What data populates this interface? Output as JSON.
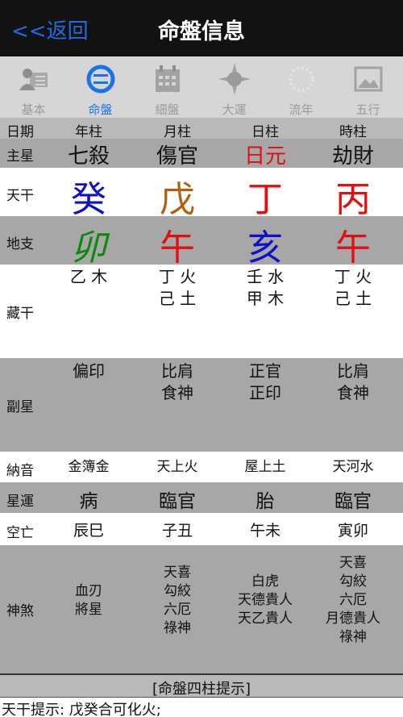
{
  "nav": {
    "back_label": "<<返回",
    "title": "命盤信息"
  },
  "tabs": [
    {
      "label": "基本",
      "icon": "person-card-icon"
    },
    {
      "label": "命盤",
      "icon": "chart-circle-icon",
      "active": true
    },
    {
      "label": "細盤",
      "icon": "calendar-icon"
    },
    {
      "label": "大運",
      "icon": "compass-star-icon"
    },
    {
      "label": "流年",
      "icon": "sun-ring-icon"
    },
    {
      "label": "五行",
      "icon": "picture-icon"
    }
  ],
  "header": {
    "label": "日期",
    "cols": [
      "年柱",
      "月柱",
      "日柱",
      "時柱"
    ]
  },
  "rows": {
    "main_star": {
      "label": "主星",
      "cols": [
        "七殺",
        "傷官",
        "日元",
        "劫財"
      ]
    },
    "heavenly_stem": {
      "label": "天干",
      "cols": [
        "癸",
        "戊",
        "丁",
        "丙"
      ]
    },
    "earthly_branch": {
      "label": "地支",
      "cols": [
        "卯",
        "午",
        "亥",
        "午"
      ]
    },
    "hidden_stems": {
      "label": "藏干",
      "cols": [
        [
          "乙 木"
        ],
        [
          "丁 火",
          "己 土"
        ],
        [
          "壬 水",
          "甲 木"
        ],
        [
          "丁 火",
          "己 土"
        ]
      ]
    },
    "secondary_star": {
      "label": "副星",
      "cols": [
        [
          "偏印"
        ],
        [
          "比肩",
          "食神"
        ],
        [
          "正官",
          "正印"
        ],
        [
          "比肩",
          "食神"
        ]
      ]
    },
    "nayin": {
      "label": "納音",
      "cols": [
        "金簿金",
        "天上火",
        "屋上土",
        "天河水"
      ]
    },
    "star_luck": {
      "label": "星運",
      "cols": [
        "病",
        "臨官",
        "胎",
        "臨官"
      ]
    },
    "void": {
      "label": "空亡",
      "cols": [
        "辰巳",
        "子丑",
        "午未",
        "寅卯"
      ]
    },
    "shensha": {
      "label": "神煞",
      "cols": [
        [
          "血刃",
          "將星"
        ],
        [
          "天喜",
          "勾絞",
          "六厄",
          "祿神"
        ],
        [
          "白虎",
          "天德貴人",
          "天乙貴人"
        ],
        [
          "天喜",
          "勾絞",
          "六厄",
          "月德貴人",
          "祿神"
        ]
      ]
    }
  },
  "colors": {
    "main_star_day": "#e01010",
    "stem": [
      "#1010c8",
      "#b0600a",
      "#e01010",
      "#e01010"
    ],
    "branch": [
      "#0a8a0a",
      "#e01010",
      "#1010c8",
      "#e01010"
    ],
    "accent": "#1a73e8"
  },
  "hint": {
    "title": "[命盤四柱提示]",
    "text": "天干提示: 戊癸合可化火;"
  }
}
